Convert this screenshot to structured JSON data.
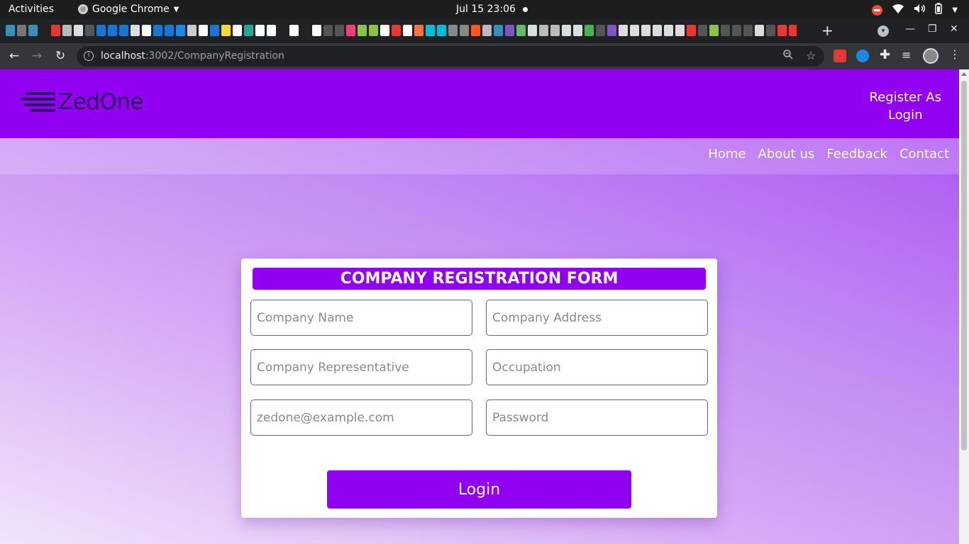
{
  "os_bar": {
    "activities": "Activities",
    "app_name": "Google Chrome",
    "clock": "Jul 15  23:06"
  },
  "browser": {
    "url_host": "localhost",
    "url_path": ":3002/CompanyRegistration",
    "tab_favicon_colors": [
      "#3a8fb7",
      "#777",
      "#3a8fb7",
      "#222",
      "#e53935",
      "#bbb",
      "#ddd",
      "#555",
      "#1976d2",
      "#1976d2",
      "#1976d2",
      "#ddd",
      "#fff",
      "#1976d2",
      "#1976d2",
      "#1e88e5",
      "#ccc",
      "#fff",
      "#1976d2",
      "#fdd835",
      "#fff",
      "#26a69a",
      "#fff",
      "#fff",
      "#222",
      "#fff",
      "#222",
      "#fff",
      "#555",
      "#555",
      "#ec407a",
      "#8bc34a",
      "#8bc34a",
      "#fff",
      "#e53935",
      "#fff",
      "#ff7043",
      "#00bcd4",
      "#00bcd4",
      "#888",
      "#888",
      "#ff5722",
      "#bbb",
      "#3a8fb7",
      "#7e57c2",
      "#66bb6a",
      "#ddd",
      "#bbb",
      "#bbb",
      "#ddd",
      "#ddd",
      "#4caf50",
      "#555",
      "#7e57c2",
      "#ddd",
      "#ddd",
      "#ddd",
      "#ddd",
      "#ddd",
      "#ddd",
      "#e53935",
      "#555",
      "#8bc34a",
      "#555",
      "#555",
      "#555",
      "#ddd",
      "#555",
      "#e53935",
      "#e53935",
      "#fbc02d",
      "#e53935",
      "#555",
      "#e53935"
    ]
  },
  "site": {
    "logo_text": "ZedOne",
    "header_links": [
      "Register As",
      "Login"
    ],
    "nav": [
      "Home",
      "About us",
      "Feedback",
      "Contact"
    ],
    "accent_color": "#9100f0"
  },
  "form": {
    "title": "COMPANY REGISTRATION FORM",
    "fields": {
      "company_name": "Company Name",
      "company_address": "Company Address",
      "company_representative": "Company Representative",
      "occupation": "Occupation",
      "email": "zedone@example.com",
      "password": "Password"
    },
    "submit_label": "Login"
  }
}
